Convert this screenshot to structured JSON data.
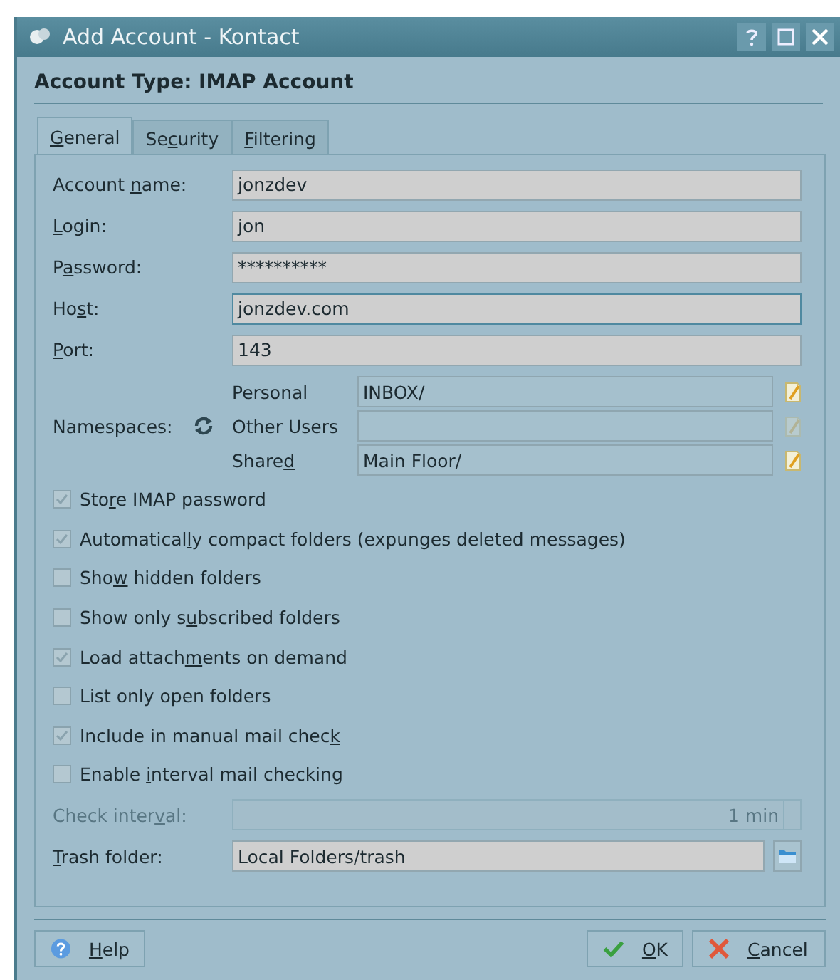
{
  "window": {
    "title": "Add Account - Kontact"
  },
  "header": "Account Type: IMAP Account",
  "tabs": [
    {
      "label": {
        "key": "G",
        "post": "eneral"
      },
      "selected": true
    },
    {
      "label": {
        "pre": "Se",
        "key": "c",
        "post": "urity"
      },
      "selected": false
    },
    {
      "label": {
        "key": "F",
        "post": "iltering"
      },
      "selected": false
    }
  ],
  "fields": [
    {
      "label": {
        "pre": "Account ",
        "key": "n",
        "post": "ame:"
      },
      "value": "jonzdev"
    },
    {
      "label": {
        "key": "L",
        "post": "ogin:"
      },
      "value": "jon"
    },
    {
      "label": {
        "pre": "P",
        "key": "a",
        "post": "ssword:"
      },
      "value": "**********"
    },
    {
      "label": {
        "pre": "Ho",
        "key": "s",
        "post": "t:"
      },
      "value": "jonzdev.com",
      "focused": true
    },
    {
      "label": {
        "key": "P",
        "post": "ort:"
      },
      "value": "143"
    }
  ],
  "namespaces": {
    "label": {
      "pre": "Namespaces:"
    },
    "rows": [
      {
        "label": {
          "pre": "Personal"
        },
        "value": "INBOX/",
        "disabled": false
      },
      {
        "label": {
          "pre": "Other Users"
        },
        "disabled": true
      },
      {
        "label": {
          "pre": "Share",
          "key": "d"
        },
        "value": "Main Floor/",
        "disabled": false
      }
    ]
  },
  "options": [
    {
      "label": {
        "pre": "Sto",
        "key": "r",
        "post": "e IMAP password"
      },
      "checked": true
    },
    {
      "label": {
        "pre": "Automatical",
        "key": "l",
        "post": "y compact folders (expunges deleted messages)"
      },
      "checked": true
    },
    {
      "label": {
        "pre": "Sho",
        "key": "w",
        "post": " hidden folders"
      },
      "checked": false
    },
    {
      "label": {
        "pre": "Show only s",
        "key": "u",
        "post": "bscribed folders"
      },
      "checked": false
    },
    {
      "label": {
        "pre": "Load attach",
        "key": "m",
        "post": "ents on demand"
      },
      "checked": true
    },
    {
      "label": {
        "pre": "List only open folders"
      },
      "checked": false
    },
    {
      "label": {
        "pre": "Include in manual mail chec",
        "key": "k"
      },
      "checked": true
    },
    {
      "label": {
        "pre": "Enable ",
        "key": "i",
        "post": "nterval mail checking"
      },
      "checked": false
    }
  ],
  "check_interval": {
    "label": {
      "pre": "Check inter",
      "key": "v",
      "post": "al:"
    },
    "value": "1 min",
    "disabled": true
  },
  "trash_folder": {
    "label": {
      "key": "T",
      "post": "rash folder:"
    },
    "value": "Local Folders/trash"
  },
  "buttons": [
    {
      "kind": "help",
      "label": {
        "key": "H",
        "post": "elp"
      }
    },
    {
      "kind": "ok",
      "label": {
        "key": "O",
        "post": "K"
      }
    },
    {
      "kind": "cancel",
      "label": {
        "key": "C",
        "post": "ancel"
      }
    }
  ]
}
